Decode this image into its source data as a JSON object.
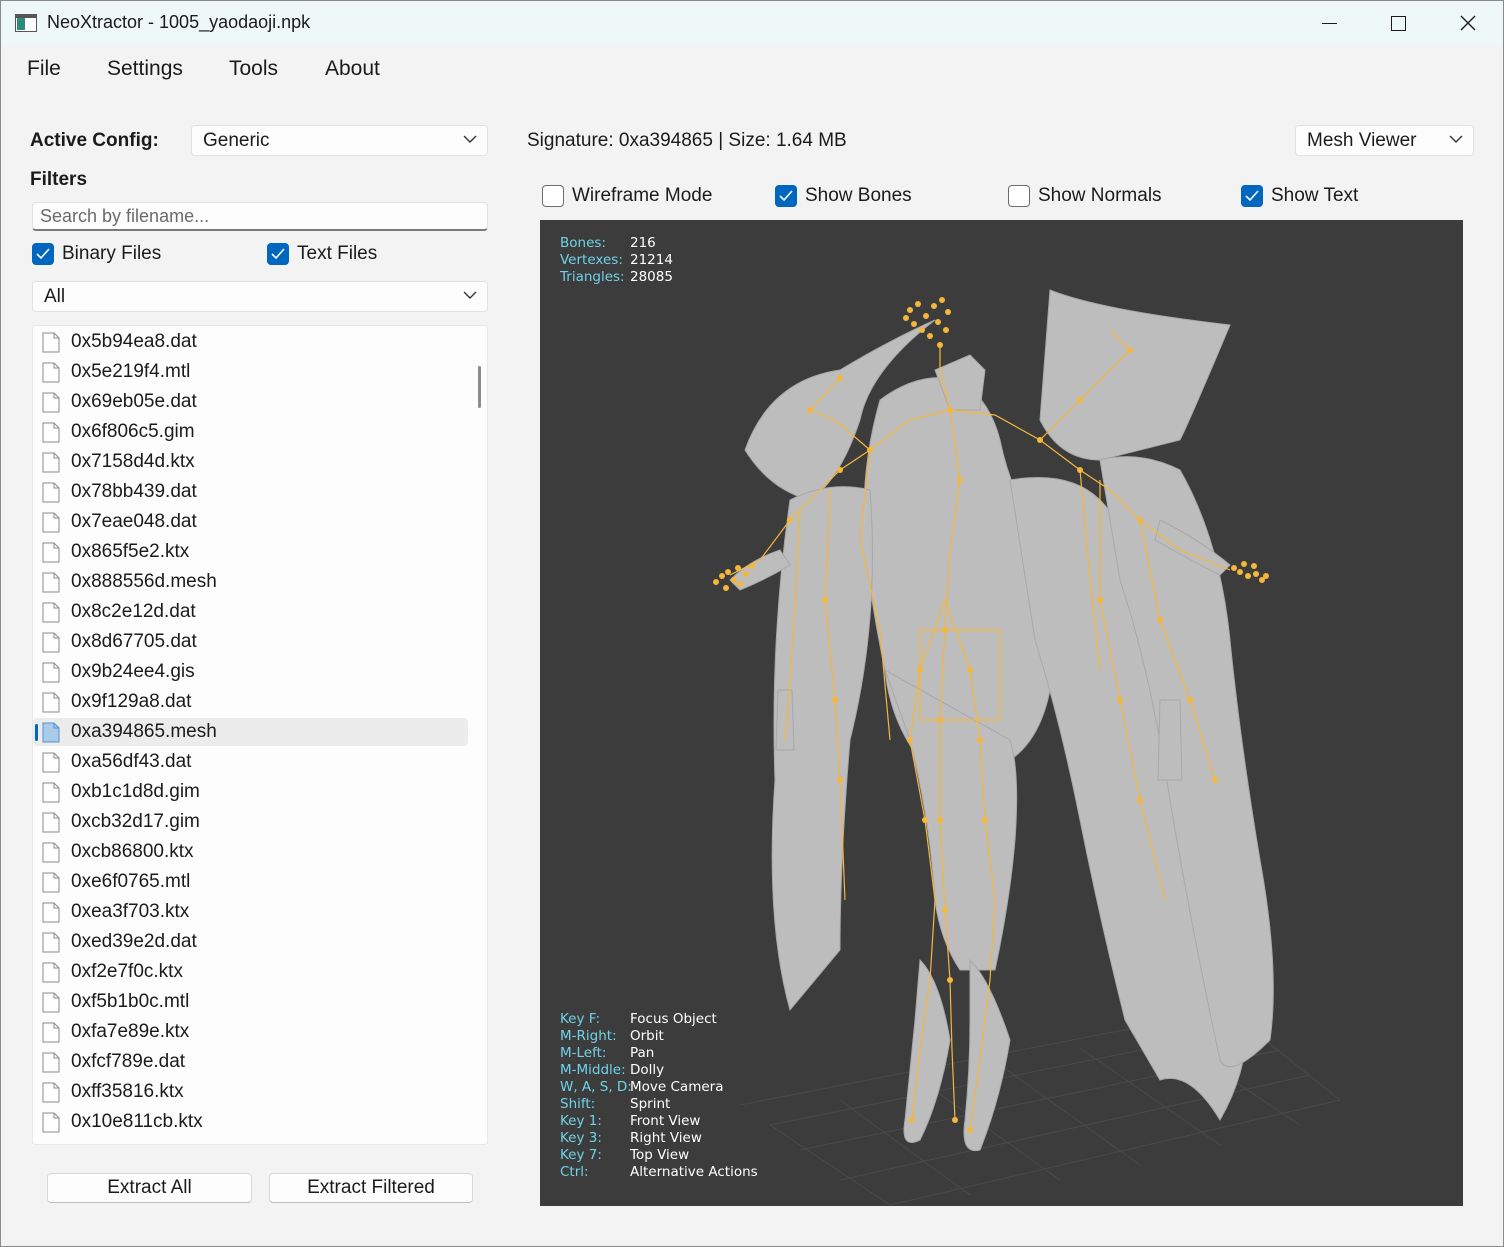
{
  "window": {
    "title": "NeoXtractor - 1005_yaodaoji.npk",
    "controls": [
      "minimize-icon",
      "maximize-icon",
      "close-icon"
    ]
  },
  "menu": [
    "File",
    "Settings",
    "Tools",
    "About"
  ],
  "left_panel": {
    "active_config_label": "Active Config:",
    "active_config_value": "Generic",
    "filters_label": "Filters",
    "search_placeholder": "Search by filename...",
    "binary_files": {
      "label": "Binary Files",
      "checked": true
    },
    "text_files": {
      "label": "Text Files",
      "checked": true
    },
    "type_filter_value": "All",
    "files": [
      "0x5b94ea8.dat",
      "0x5e219f4.mtl",
      "0x69eb05e.dat",
      "0x6f806c5.gim",
      "0x7158d4d.ktx",
      "0x78bb439.dat",
      "0x7eae048.dat",
      "0x865f5e2.ktx",
      "0x888556d.mesh",
      "0x8c2e12d.dat",
      "0x8d67705.dat",
      "0x9b24ee4.gis",
      "0x9f129a8.dat",
      "0xa394865.mesh",
      "0xa56df43.dat",
      "0xb1c1d8d.gim",
      "0xcb32d17.gim",
      "0xcb86800.ktx",
      "0xe6f0765.mtl",
      "0xea3f703.ktx",
      "0xed39e2d.dat",
      "0xf2e7f0c.ktx",
      "0xf5b1b0c.mtl",
      "0xfa7e89e.ktx",
      "0xfcf789e.dat",
      "0xff35816.ktx",
      "0x10e811cb.ktx"
    ],
    "selected_file": "0xa394865.mesh",
    "extract_all_label": "Extract All",
    "extract_filtered_label": "Extract Filtered"
  },
  "right_panel": {
    "signature_text": "Signature: 0xa394865 | Size: 1.64 MB",
    "viewer_mode": "Mesh Viewer",
    "options": [
      {
        "label": "Wireframe Mode",
        "checked": false
      },
      {
        "label": "Show Bones",
        "checked": true
      },
      {
        "label": "Show Normals",
        "checked": false
      },
      {
        "label": "Show Text",
        "checked": true
      }
    ],
    "stats": [
      {
        "key": "Bones:",
        "value": "216"
      },
      {
        "key": "Vertexes:",
        "value": "21214"
      },
      {
        "key": "Triangles:",
        "value": "28085"
      }
    ],
    "key_help": [
      {
        "key": "Key F:",
        "value": "Focus Object"
      },
      {
        "key": "M-Right:",
        "value": "Orbit"
      },
      {
        "key": "M-Left:",
        "value": "Pan"
      },
      {
        "key": "M-Middle:",
        "value": "Dolly"
      },
      {
        "key": "W, A, S, D:",
        "value": "Move Camera"
      },
      {
        "key": "Shift:",
        "value": "Sprint"
      },
      {
        "key": "Key 1:",
        "value": "Front View"
      },
      {
        "key": "Key 3:",
        "value": "Right View"
      },
      {
        "key": "Key 7:",
        "value": "Top View"
      },
      {
        "key": "Ctrl:",
        "value": "Alternative Actions"
      }
    ],
    "colors": {
      "viewport_bg": "#3c3c3c",
      "mesh": "#bdbdbd",
      "bones": "#f5b73b",
      "key_label": "#6fd3e8",
      "accent": "#0067c0"
    }
  }
}
